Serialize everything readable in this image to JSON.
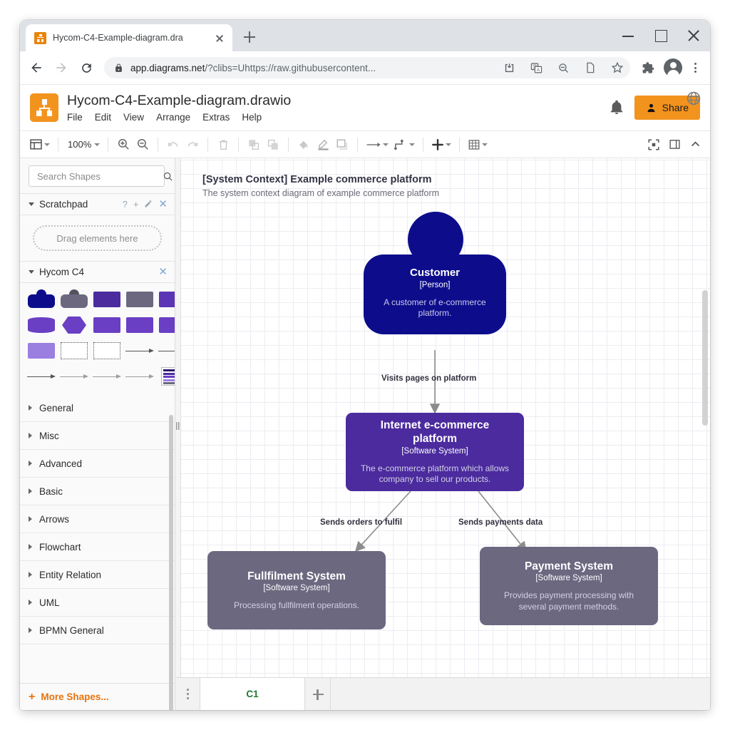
{
  "browser": {
    "tab": {
      "title": "Hycom-C4-Example-diagram.dra",
      "favicon": "drawio-favicon",
      "close": "close-icon"
    },
    "new_tab": "new-tab-icon",
    "window_controls": {
      "minimize": "minimize-icon",
      "maximize": "maximize-icon",
      "close": "close-icon"
    },
    "nav": {
      "back": "back-arrow-icon",
      "forward": "forward-arrow-icon",
      "reload": "reload-icon"
    },
    "omnibox": {
      "lock": "lock-icon",
      "url_host": "app.diagrams.net",
      "url_rest": "/?clibs=Uhttps://raw.githubusercontent...",
      "icons": [
        "download-icon",
        "translate-icon",
        "zoom-out-icon",
        "page-icon",
        "star-icon"
      ]
    },
    "extensions_icon": "puzzle-icon",
    "profile_icon": "profile-avatar-icon",
    "menu_icon": "three-dots-menu-icon"
  },
  "app": {
    "logo": "drawio-logo",
    "document_title": "Hycom-C4-Example-diagram.drawio",
    "menus": [
      "File",
      "Edit",
      "View",
      "Arrange",
      "Extras",
      "Help"
    ],
    "notification_icon": "bell-icon",
    "share_label": "Share",
    "share_icon": "person-icon",
    "language_icon": "globe-icon",
    "accent_orange": "#f2931e"
  },
  "toolbar": {
    "view_layout_icon": "view-layout-icon",
    "zoom_level": "100%",
    "zoom_in_icon": "zoom-in-icon",
    "zoom_out_icon": "zoom-out-icon",
    "undo_icon": "undo-icon",
    "redo_icon": "redo-icon",
    "delete_icon": "trash-icon",
    "to_front_icon": "bring-to-front-icon",
    "to_back_icon": "send-to-back-icon",
    "fill_color_icon": "fill-color-icon",
    "line_color_icon": "line-color-icon",
    "shadow_icon": "shadow-icon",
    "connection_icon": "connection-arrow-icon",
    "waypoints_icon": "waypoints-icon",
    "insert_icon": "insert-plus-icon",
    "table_icon": "table-icon",
    "fullscreen_icon": "fullscreen-icon",
    "format_panel_icon": "format-panel-icon",
    "collapse_icon": "collapse-chevron-icon"
  },
  "sidebar": {
    "search": {
      "placeholder": "Search Shapes",
      "value": "",
      "icon": "search-icon"
    },
    "scratchpad": {
      "label": "Scratchpad",
      "help": "?",
      "add": "+",
      "edit": "pencil-icon",
      "close": "close-icon",
      "drop_hint": "Drag elements here"
    },
    "shape_library": {
      "label": "Hycom C4",
      "close": "close-icon",
      "shapes": [
        {
          "name": "person-dark-blue",
          "kind": "person",
          "color": "#0d0d8c"
        },
        {
          "name": "person-gray",
          "kind": "person",
          "color": "#6b6880"
        },
        {
          "name": "system-box-purple",
          "kind": "box",
          "color": "#4b2b9e"
        },
        {
          "name": "system-box-gray",
          "kind": "box",
          "color": "#6b6880"
        },
        {
          "name": "system-box-violet",
          "kind": "box",
          "color": "#6a3fc4"
        },
        {
          "name": "database-cylinder",
          "kind": "cylinder",
          "color": "#6a3fc4"
        },
        {
          "name": "hexagon-component",
          "kind": "hexagon",
          "color": "#6a3fc4"
        },
        {
          "name": "container-3d-box",
          "kind": "box3d",
          "color": "#6a3fc4"
        },
        {
          "name": "component-box",
          "kind": "box",
          "color": "#6a3fc4"
        },
        {
          "name": "component-box-2",
          "kind": "box",
          "color": "#6a3fc4"
        },
        {
          "name": "external-box-light",
          "kind": "box",
          "color": "#9a7ee0"
        },
        {
          "name": "boundary-dashed-1",
          "kind": "dashed",
          "color": "#ffffff"
        },
        {
          "name": "boundary-dashed-2",
          "kind": "dashed",
          "color": "#ffffff"
        },
        {
          "name": "relationship-arrow-1",
          "kind": "arrow",
          "color": "#555555"
        },
        {
          "name": "relationship-arrow-2",
          "kind": "arrow",
          "color": "#555555"
        },
        {
          "name": "relationship-arrow-3",
          "kind": "arrow",
          "color": "#555555"
        },
        {
          "name": "relationship-arrow-4",
          "kind": "arrow",
          "color": "#888888"
        },
        {
          "name": "relationship-arrow-5",
          "kind": "arrow",
          "color": "#888888"
        },
        {
          "name": "relationship-arrow-6",
          "kind": "arrow",
          "color": "#888888"
        },
        {
          "name": "legend-block",
          "kind": "legend",
          "color": "#4b2b9e"
        }
      ]
    },
    "categories": [
      "General",
      "Misc",
      "Advanced",
      "Basic",
      "Arrows",
      "Flowchart",
      "Entity Relation",
      "UML",
      "BPMN General"
    ],
    "more_shapes": "More Shapes...",
    "more_shapes_plus": "+"
  },
  "diagram": {
    "title": "[System Context] Example commerce platform",
    "subtitle": "The system context diagram of example commerce platform",
    "nodes": [
      {
        "id": "customer",
        "shape": "person",
        "name": "Customer",
        "type": "[Person]",
        "description": "A customer of e-commerce platform.",
        "color": "#0d0d8c"
      },
      {
        "id": "ecommerce",
        "shape": "box",
        "name": "Internet e-commerce platform",
        "type": "[Software System]",
        "description": "The e-commerce platform which allows company to sell our products.",
        "color": "#4b2b9e"
      },
      {
        "id": "fulfilment",
        "shape": "box",
        "name": "Fullfilment System",
        "type": "[Software System]",
        "description": "Processing fullfilment operations.",
        "color": "#6b6880"
      },
      {
        "id": "payment",
        "shape": "box",
        "name": "Payment System",
        "type": "[Software System]",
        "description": "Provides payment processing with several payment methods.",
        "color": "#6b6880"
      }
    ],
    "edges": [
      {
        "from": "customer",
        "to": "ecommerce",
        "label": "Visits pages on platform"
      },
      {
        "from": "ecommerce",
        "to": "fulfilment",
        "label": "Sends orders to fulfil"
      },
      {
        "from": "ecommerce",
        "to": "payment",
        "label": "Sends payments data"
      }
    ]
  },
  "sheets": {
    "menu_icon": "sheet-menu-icon",
    "tabs": [
      {
        "label": "C1",
        "active": true
      }
    ],
    "add_icon": "add-sheet-icon"
  }
}
